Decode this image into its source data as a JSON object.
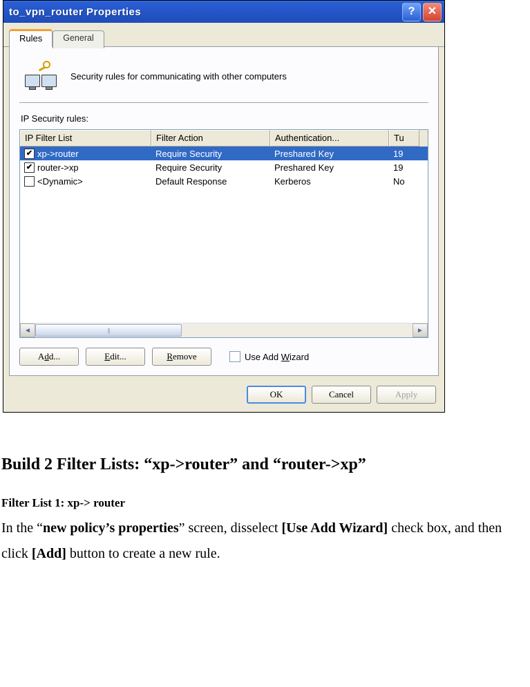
{
  "dialog": {
    "title": "to_vpn_router Properties",
    "tabs": {
      "active": "Rules",
      "inactive": "General"
    },
    "desc": "Security rules for communicating with other computers",
    "rules_label": "IP Security rules:",
    "columns": {
      "c0": "IP Filter List",
      "c1": "Filter Action",
      "c2": "Authentication...",
      "c3": "Tu"
    },
    "rows": [
      {
        "checked": true,
        "selected": true,
        "c0": "xp->router",
        "c1": "Require Security",
        "c2": "Preshared Key",
        "c3": "19"
      },
      {
        "checked": true,
        "selected": false,
        "c0": "router->xp",
        "c1": "Require Security",
        "c2": "Preshared Key",
        "c3": "19"
      },
      {
        "checked": false,
        "selected": false,
        "c0": "<Dynamic>",
        "c1": "Default Response",
        "c2": "Kerberos",
        "c3": "No"
      }
    ],
    "buttons": {
      "add": "Add...",
      "edit": "Edit...",
      "remove": "Remove",
      "wizard": "Use Add Wizard"
    },
    "dlg": {
      "ok": "OK",
      "cancel": "Cancel",
      "apply": "Apply"
    }
  },
  "doc": {
    "heading": "Build 2 Filter Lists: “xp->router” and “router->xp”",
    "sub": "Filter List 1: xp-> router",
    "p1a": "In the “",
    "p1b": "new policy’s properties",
    "p1c": "” screen, disselect ",
    "p1d": "[Use Add Wizard]",
    "p1e": " check box, and then click ",
    "p1f": "[Add]",
    "p1g": " button to create a new rule."
  }
}
